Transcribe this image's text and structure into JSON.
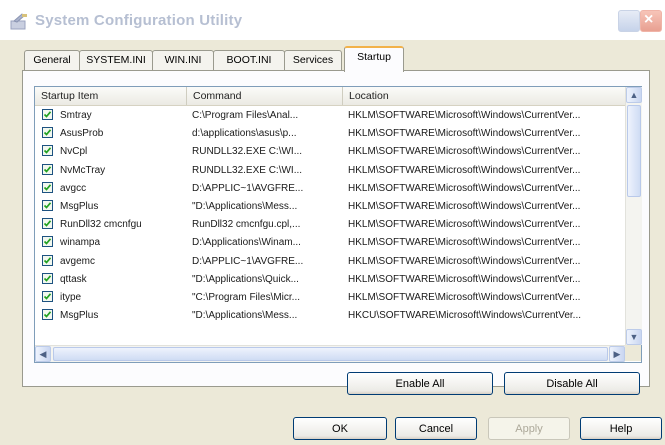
{
  "window": {
    "title": "System Configuration Utility"
  },
  "tabs": [
    {
      "label": "General"
    },
    {
      "label": "SYSTEM.INI"
    },
    {
      "label": "WIN.INI"
    },
    {
      "label": "BOOT.INI"
    },
    {
      "label": "Services"
    },
    {
      "label": "Startup",
      "active": true
    }
  ],
  "table": {
    "columns": [
      "Startup Item",
      "Command",
      "Location"
    ],
    "rows": [
      {
        "checked": true,
        "item": "Smtray",
        "command": "C:\\Program Files\\Anal...",
        "location": "HKLM\\SOFTWARE\\Microsoft\\Windows\\CurrentVer..."
      },
      {
        "checked": true,
        "item": "AsusProb",
        "command": "d:\\applications\\asus\\p...",
        "location": "HKLM\\SOFTWARE\\Microsoft\\Windows\\CurrentVer..."
      },
      {
        "checked": true,
        "item": "NvCpl",
        "command": "RUNDLL32.EXE C:\\WI...",
        "location": "HKLM\\SOFTWARE\\Microsoft\\Windows\\CurrentVer..."
      },
      {
        "checked": true,
        "item": "NvMcTray",
        "command": "RUNDLL32.EXE C:\\WI...",
        "location": "HKLM\\SOFTWARE\\Microsoft\\Windows\\CurrentVer..."
      },
      {
        "checked": true,
        "item": "avgcc",
        "command": "D:\\APPLIC~1\\AVGFRE...",
        "location": "HKLM\\SOFTWARE\\Microsoft\\Windows\\CurrentVer..."
      },
      {
        "checked": true,
        "item": "MsgPlus",
        "command": "\"D:\\Applications\\Mess...",
        "location": "HKLM\\SOFTWARE\\Microsoft\\Windows\\CurrentVer..."
      },
      {
        "checked": true,
        "item": "RunDll32 cmcnfgu",
        "command": "RunDll32 cmcnfgu.cpl,...",
        "location": "HKLM\\SOFTWARE\\Microsoft\\Windows\\CurrentVer..."
      },
      {
        "checked": true,
        "item": "winampa",
        "command": "D:\\Applications\\Winam...",
        "location": "HKLM\\SOFTWARE\\Microsoft\\Windows\\CurrentVer..."
      },
      {
        "checked": true,
        "item": "avgemc",
        "command": "D:\\APPLIC~1\\AVGFRE...",
        "location": "HKLM\\SOFTWARE\\Microsoft\\Windows\\CurrentVer..."
      },
      {
        "checked": true,
        "item": "qttask",
        "command": "\"D:\\Applications\\Quick...",
        "location": "HKLM\\SOFTWARE\\Microsoft\\Windows\\CurrentVer..."
      },
      {
        "checked": true,
        "item": "itype",
        "command": "\"C:\\Program Files\\Micr...",
        "location": "HKLM\\SOFTWARE\\Microsoft\\Windows\\CurrentVer..."
      },
      {
        "checked": true,
        "item": "MsgPlus",
        "command": "\"D:\\Applications\\Mess...",
        "location": "HKCU\\SOFTWARE\\Microsoft\\Windows\\CurrentVer..."
      }
    ]
  },
  "buttons": {
    "enable_all": "Enable All",
    "disable_all": "Disable All",
    "ok": "OK",
    "cancel": "Cancel",
    "apply": "Apply",
    "help": "Help"
  },
  "icons": {
    "app": "system-config-icon",
    "help": "help-icon",
    "close": "close-icon",
    "scroll_up": "scroll-up-arrow-icon",
    "scroll_down": "scroll-down-arrow-icon",
    "scroll_left": "scroll-left-arrow-icon",
    "scroll_right": "scroll-right-arrow-icon",
    "checkbox": "checkbox-checked-icon"
  },
  "colors": {
    "accent_border": "#003c74",
    "active_tab_highlight": "#f2b24a",
    "check_color": "#21a121"
  }
}
